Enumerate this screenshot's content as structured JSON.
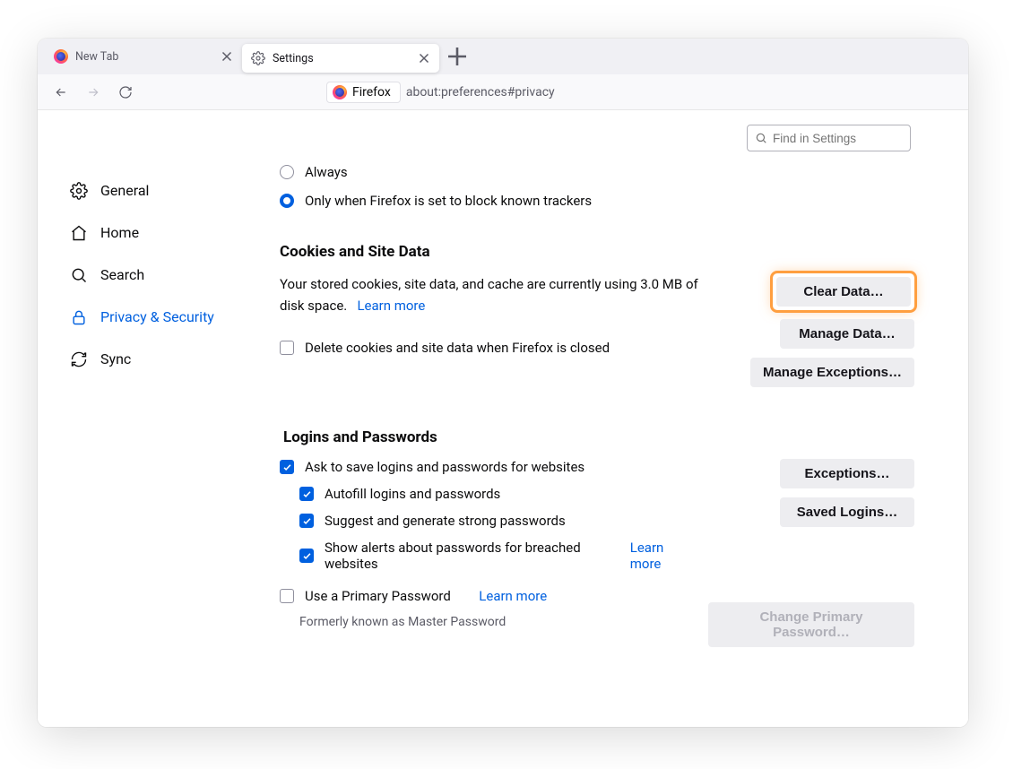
{
  "tabs": {
    "inactive_label": "New Tab",
    "active_label": "Settings"
  },
  "url": {
    "identity_label": "Firefox",
    "path": "about:preferences#privacy"
  },
  "search": {
    "placeholder": "Find in Settings"
  },
  "sidebar": {
    "items": [
      {
        "label": "General"
      },
      {
        "label": "Home"
      },
      {
        "label": "Search"
      },
      {
        "label": "Privacy & Security"
      },
      {
        "label": "Sync"
      }
    ]
  },
  "trackers": {
    "opt_always": "Always",
    "opt_blocked": "Only when Firefox is set to block known trackers"
  },
  "cookies": {
    "heading": "Cookies and Site Data",
    "desc": "Your stored cookies, site data, and cache are currently using 3.0 MB of disk space.",
    "learn_more": "Learn more",
    "delete_on_close": "Delete cookies and site data when Firefox is closed",
    "btn_clear": "Clear Data…",
    "btn_manage": "Manage Data…",
    "btn_exceptions": "Manage Exceptions…"
  },
  "logins": {
    "heading": "Logins and Passwords",
    "ask_save": "Ask to save logins and passwords for websites",
    "autofill": "Autofill logins and passwords",
    "suggest": "Suggest and generate strong passwords",
    "alerts": "Show alerts about passwords for breached websites",
    "alerts_learn": "Learn more",
    "use_primary": "Use a Primary Password",
    "primary_learn": "Learn more",
    "note": "Formerly known as Master Password",
    "btn_exceptions": "Exceptions…",
    "btn_saved": "Saved Logins…",
    "btn_change": "Change Primary Password…"
  }
}
